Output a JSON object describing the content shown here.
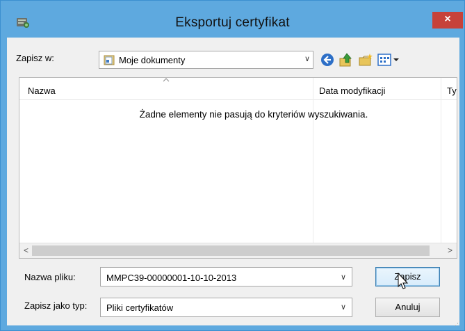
{
  "window": {
    "title": "Eksportuj certyfikat",
    "close_glyph": "×"
  },
  "lookin": {
    "label": "Zapisz w:",
    "value": "Moje dokumenty",
    "folder_icon": "documents-folder-icon",
    "caret": "∨"
  },
  "toolbar": {
    "back_icon": "back-arrow-icon",
    "up_icon": "up-folder-icon",
    "new_folder_icon": "new-folder-icon",
    "view_icon": "view-menu-icon"
  },
  "listview": {
    "columns": [
      "Nazwa",
      "Data modyfikacji",
      "Ty"
    ],
    "empty_message": "Żadne elementy nie pasują do kryteriów wyszukiwania.",
    "scroll_left": "<",
    "scroll_right": ">"
  },
  "filename": {
    "label": "Nazwa pliku:",
    "value": "MMPC39-00000001-10-10-2013",
    "caret": "∨"
  },
  "filetype": {
    "label": "Zapisz jako typ:",
    "value": "Pliki certyfikatów",
    "caret": "∨"
  },
  "buttons": {
    "save": "Zapisz",
    "cancel": "Anuluj"
  },
  "colors": {
    "title_bar": "#5ea9df",
    "close": "#c7423a",
    "client": "#f0f0f0"
  }
}
